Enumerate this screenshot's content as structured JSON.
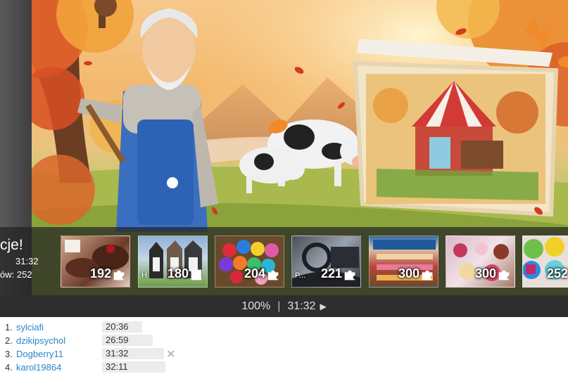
{
  "overlay": {
    "congrats_text": "cje!",
    "time_text": "31:32",
    "pieces_text": "ów: 252"
  },
  "thumbnails": [
    {
      "count": "192",
      "tag": ""
    },
    {
      "count": "180",
      "tag": "H"
    },
    {
      "count": "204",
      "tag": ""
    },
    {
      "count": "221",
      "tag": "P..."
    },
    {
      "count": "300",
      "tag": ""
    },
    {
      "count": "300",
      "tag": ""
    },
    {
      "count": "252",
      "tag": ""
    }
  ],
  "statusbar": {
    "zoom": "100%",
    "separator": "|",
    "timer": "31:32",
    "play_icon": "▶"
  },
  "leaderboard": [
    {
      "rank": "1.",
      "user": "sylciafi",
      "time": "20:36",
      "removable": false
    },
    {
      "rank": "2.",
      "user": "dzikipsychol",
      "time": "26:59",
      "removable": false
    },
    {
      "rank": "3.",
      "user": "Dogberry11",
      "time": "31:32",
      "removable": true
    },
    {
      "rank": "4.",
      "user": "karol19864",
      "time": "32:11",
      "removable": false
    }
  ],
  "remove_icon": "✕",
  "colors": {
    "accent_link": "#2a86c6",
    "bar_bg": "#2e2e2e"
  }
}
